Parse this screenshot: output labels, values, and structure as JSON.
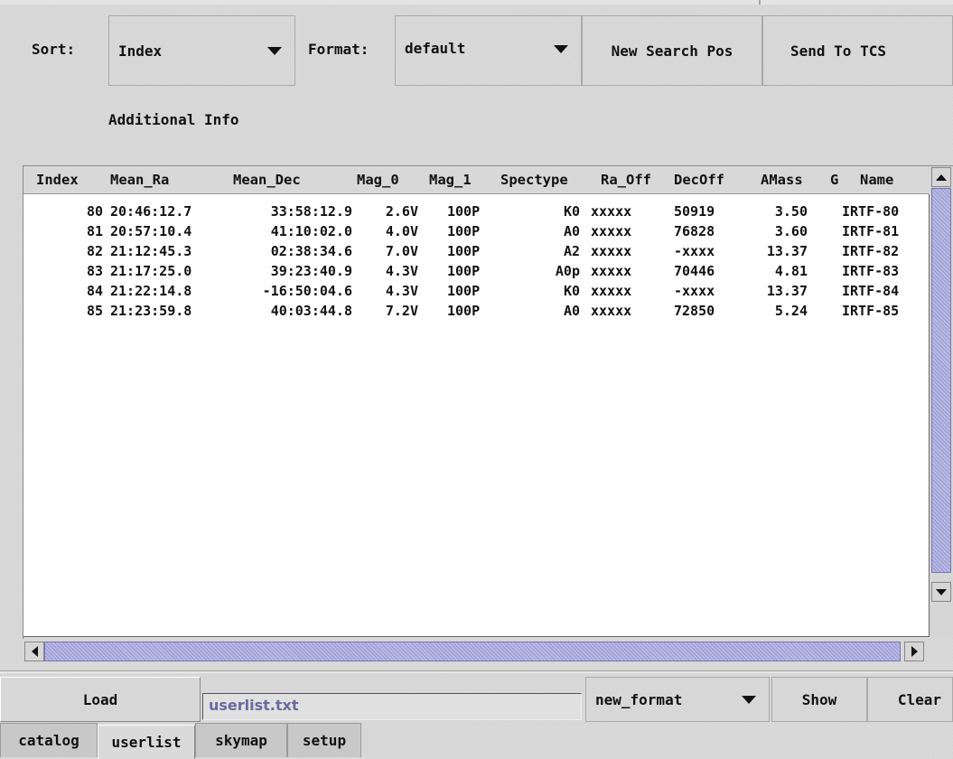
{
  "toolbar": {
    "sort_label": "Sort:",
    "sort_value": "Index",
    "format_label": "Format:",
    "format_value": "default",
    "new_search_pos": "New Search Pos",
    "send_to_tcs": "Send To TCS",
    "additional_info": "Additional Info"
  },
  "table": {
    "columns": [
      "Index",
      "Mean_Ra",
      "Mean_Dec",
      "Mag_0",
      "Mag_1",
      "Spectype",
      "Ra_Off",
      "DecOff",
      "AMass",
      "G",
      "Name"
    ],
    "rows": [
      [
        "80",
        "20:46:12.7",
        "33:58:12.9",
        "2.6V",
        "100P",
        "K0",
        "xxxxx",
        "50919",
        "3.50",
        "",
        "IRTF-80"
      ],
      [
        "81",
        "20:57:10.4",
        "41:10:02.0",
        "4.0V",
        "100P",
        "A0",
        "xxxxx",
        "76828",
        "3.60",
        "",
        "IRTF-81"
      ],
      [
        "82",
        "21:12:45.3",
        "02:38:34.6",
        "7.0V",
        "100P",
        "A2",
        "xxxxx",
        "-xxxx",
        "13.37",
        "",
        "IRTF-82"
      ],
      [
        "83",
        "21:17:25.0",
        "39:23:40.9",
        "4.3V",
        "100P",
        "A0p",
        "xxxxx",
        "70446",
        "4.81",
        "",
        "IRTF-83"
      ],
      [
        "84",
        "21:22:14.8",
        "-16:50:04.6",
        "4.3V",
        "100P",
        "K0",
        "xxxxx",
        "-xxxx",
        "13.37",
        "",
        "IRTF-84"
      ],
      [
        "85",
        "21:23:59.8",
        "40:03:44.8",
        "7.2V",
        "100P",
        "A0",
        "xxxxx",
        "72850",
        "5.24",
        "",
        "IRTF-85"
      ]
    ]
  },
  "bottom": {
    "load": "Load",
    "filename": "userlist.txt",
    "format_value": "new_format",
    "show": "Show",
    "clear": "Clear"
  },
  "tabs": [
    "catalog",
    "userlist",
    "skymap",
    "setup"
  ],
  "active_tab": "userlist"
}
